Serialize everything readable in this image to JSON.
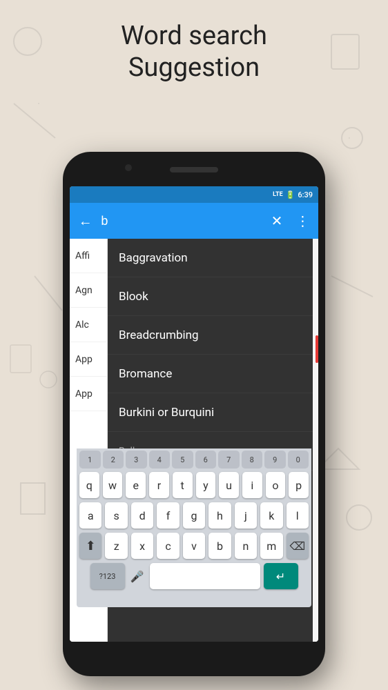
{
  "page": {
    "title_line1": "Word search",
    "title_line2": "Suggestion"
  },
  "status_bar": {
    "lte": "LTE",
    "battery": "⚡",
    "time": "6:39"
  },
  "app_bar": {
    "back_icon": "←",
    "search_value": "b",
    "clear_icon": "✕",
    "more_icon": "⋮"
  },
  "left_column": {
    "items": [
      "Affi",
      "Agn",
      "Alc",
      "App",
      "App"
    ]
  },
  "dropdown": {
    "items": [
      "Baggravation",
      "Blook",
      "Breadcrumbing",
      "Bromance",
      "Burkini or Burquini",
      "Bulle..."
    ]
  },
  "keyboard": {
    "number_row": [
      "1",
      "2",
      "3",
      "4",
      "5",
      "6",
      "7",
      "8",
      "9",
      "0"
    ],
    "row1": [
      "q",
      "w",
      "e",
      "r",
      "t",
      "y",
      "u",
      "i",
      "o",
      "p"
    ],
    "row2": [
      "a",
      "s",
      "d",
      "f",
      "g",
      "h",
      "j",
      "k",
      "l"
    ],
    "row3": [
      "z",
      "x",
      "c",
      "v",
      "b",
      "n",
      "m"
    ],
    "shift_symbol": "⬆",
    "backspace_symbol": "⌫",
    "symbols_label": "?123",
    "enter_symbol": "↵",
    "mic_symbol": "🎤"
  }
}
